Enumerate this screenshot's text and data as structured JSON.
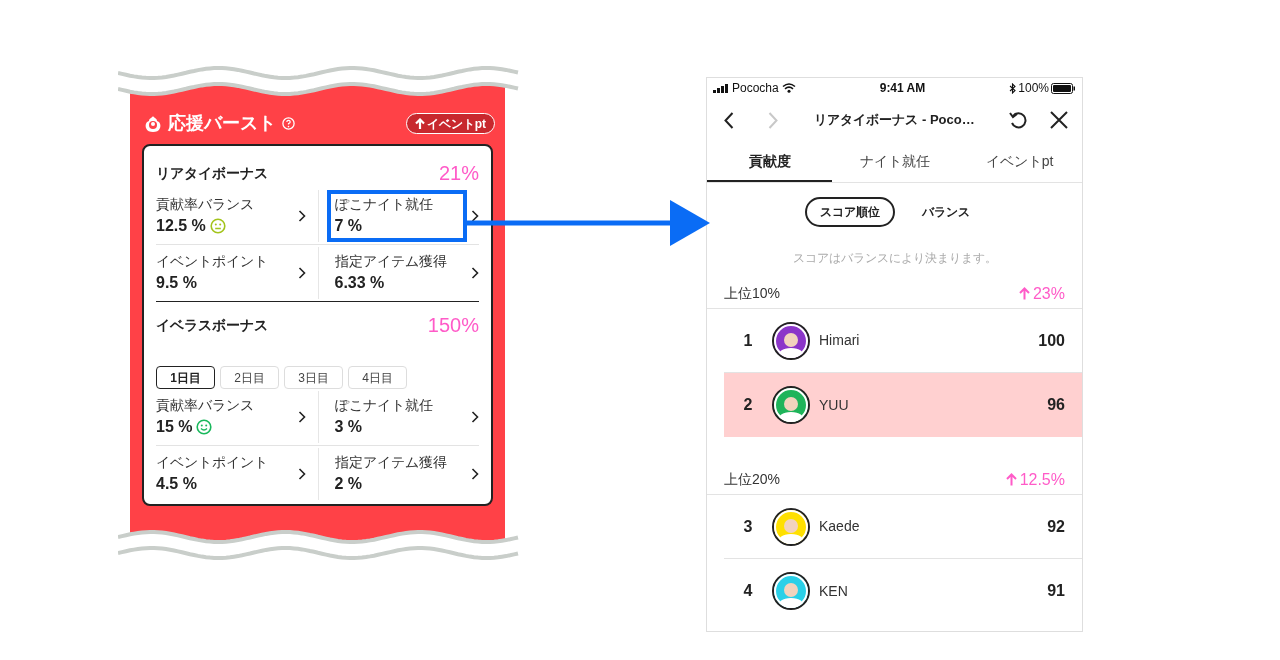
{
  "boost_card": {
    "title": "応援バースト",
    "badge": "イベントpt",
    "sections": [
      {
        "title": "リアタイボーナス",
        "total": "21%",
        "items": [
          {
            "label": "貢献率バランス",
            "value": "12.5 %",
            "kind": "neutral",
            "highlighted": false
          },
          {
            "label": "ぽこナイト就任",
            "value": "7 %",
            "kind": "plain",
            "highlighted": true
          },
          {
            "label": "イベントポイント",
            "value": "9.5 %",
            "kind": "plain",
            "highlighted": false
          },
          {
            "label": "指定アイテム獲得",
            "value": "6.33 %",
            "kind": "plain",
            "highlighted": false
          }
        ]
      },
      {
        "title": "イベラスボーナス",
        "total": "150%",
        "days": [
          {
            "label": "1日目",
            "selected": true
          },
          {
            "label": "2日目",
            "selected": false
          },
          {
            "label": "3日目",
            "selected": false
          },
          {
            "label": "4日目",
            "selected": false
          }
        ],
        "items": [
          {
            "label": "貢献率バランス",
            "value": "15 %",
            "kind": "smile",
            "highlighted": false
          },
          {
            "label": "ぽこナイト就任",
            "value": "3 %",
            "kind": "plain",
            "highlighted": false
          },
          {
            "label": "イベントポイント",
            "value": "4.5 %",
            "kind": "plain",
            "highlighted": false
          },
          {
            "label": "指定アイテム獲得",
            "value": "2 %",
            "kind": "plain",
            "highlighted": false
          }
        ]
      }
    ]
  },
  "phone": {
    "status_bar": {
      "carrier": "Pococha",
      "time": "9:41 AM",
      "battery": "100%"
    },
    "nav": {
      "title": "リアタイボーナス - Poco…",
      "forward_disabled": true
    },
    "tabs": [
      {
        "label": "貢献度",
        "selected": true
      },
      {
        "label": "ナイト就任",
        "selected": false
      },
      {
        "label": "イベントpt",
        "selected": false
      }
    ],
    "segments": [
      {
        "label": "スコア順位",
        "selected": true
      },
      {
        "label": "バランス",
        "selected": false
      }
    ],
    "hint": "スコアはバランスにより決まります。",
    "groups": [
      {
        "label": "上位10%",
        "bonus": "23%",
        "rows": [
          {
            "rank": "1",
            "name": "Himari",
            "score": "100",
            "color": "#8b35c9",
            "selected": false
          },
          {
            "rank": "2",
            "name": "YUU",
            "score": "96",
            "color": "#1fb45a",
            "selected": true
          }
        ]
      },
      {
        "label": "上位20%",
        "bonus": "12.5%",
        "rows": [
          {
            "rank": "3",
            "name": "Kaede",
            "score": "92",
            "color": "#ffe000",
            "selected": false
          },
          {
            "rank": "4",
            "name": "KEN",
            "score": "91",
            "color": "#2ad0e8",
            "selected": false
          }
        ]
      }
    ]
  }
}
